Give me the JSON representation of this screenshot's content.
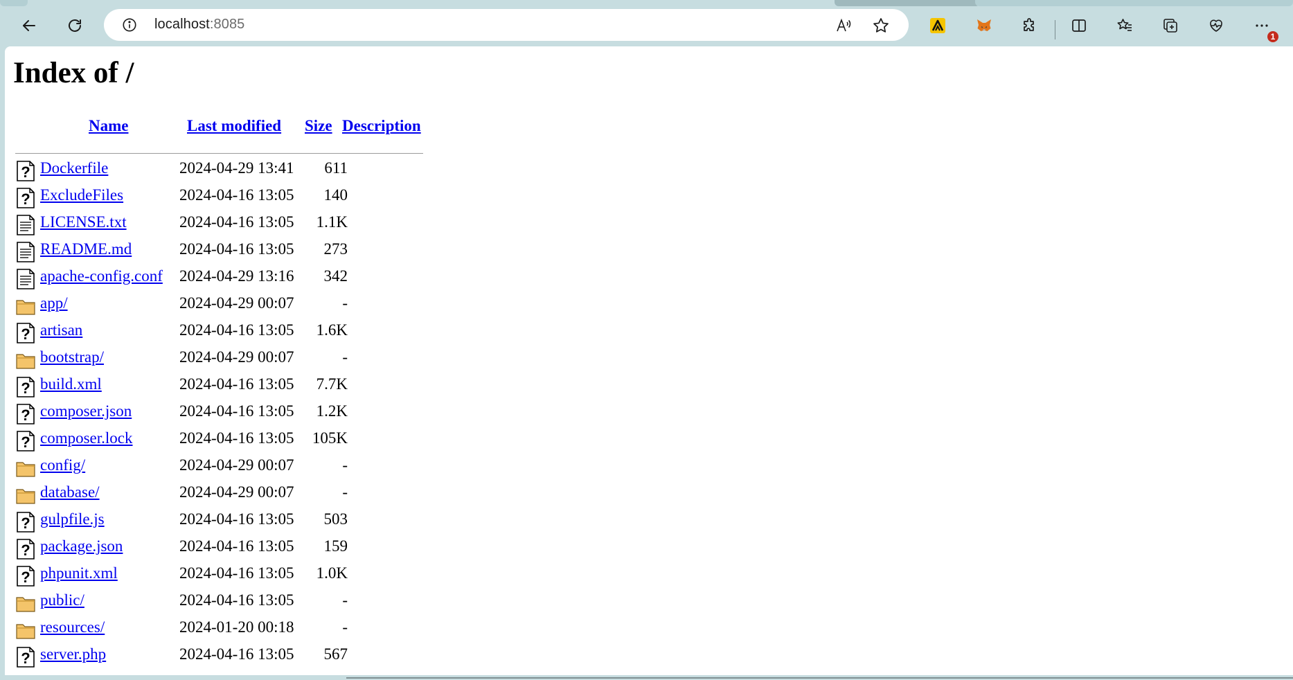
{
  "browser": {
    "url_host": "localhost",
    "url_port": ":8085",
    "url": "localhost:8085",
    "notification_count": "1",
    "toolbar_icons": [
      "back-icon",
      "refresh-icon",
      "info-icon",
      "read-aloud-icon",
      "favorite-star-icon",
      "extension-a-icon",
      "metamask-fox-icon",
      "extensions-puzzle-icon",
      "split-screen-icon",
      "favorites-icon",
      "collections-icon",
      "browser-essentials-icon",
      "more-icon"
    ]
  },
  "page": {
    "title": "Index of /",
    "columns": {
      "name": "Name",
      "last_modified": "Last modified",
      "size": "Size",
      "description": "Description"
    },
    "entries": [
      {
        "icon": "unknown-file-icon",
        "name": "Dockerfile",
        "modified": "2024-04-29 13:41",
        "size": "611",
        "description": ""
      },
      {
        "icon": "unknown-file-icon",
        "name": "ExcludeFiles",
        "modified": "2024-04-16 13:05",
        "size": "140",
        "description": ""
      },
      {
        "icon": "text-file-icon",
        "name": "LICENSE.txt",
        "modified": "2024-04-16 13:05",
        "size": "1.1K",
        "description": ""
      },
      {
        "icon": "text-file-icon",
        "name": "README.md",
        "modified": "2024-04-16 13:05",
        "size": "273",
        "description": ""
      },
      {
        "icon": "text-file-icon",
        "name": "apache-config.conf",
        "modified": "2024-04-29 13:16",
        "size": "342",
        "description": ""
      },
      {
        "icon": "folder-icon",
        "name": "app/",
        "modified": "2024-04-29 00:07",
        "size": "-",
        "description": ""
      },
      {
        "icon": "unknown-file-icon",
        "name": "artisan",
        "modified": "2024-04-16 13:05",
        "size": "1.6K",
        "description": ""
      },
      {
        "icon": "folder-icon",
        "name": "bootstrap/",
        "modified": "2024-04-29 00:07",
        "size": "-",
        "description": ""
      },
      {
        "icon": "unknown-file-icon",
        "name": "build.xml",
        "modified": "2024-04-16 13:05",
        "size": "7.7K",
        "description": ""
      },
      {
        "icon": "unknown-file-icon",
        "name": "composer.json",
        "modified": "2024-04-16 13:05",
        "size": "1.2K",
        "description": ""
      },
      {
        "icon": "unknown-file-icon",
        "name": "composer.lock",
        "modified": "2024-04-16 13:05",
        "size": "105K",
        "description": ""
      },
      {
        "icon": "folder-icon",
        "name": "config/",
        "modified": "2024-04-29 00:07",
        "size": "-",
        "description": ""
      },
      {
        "icon": "folder-icon",
        "name": "database/",
        "modified": "2024-04-29 00:07",
        "size": "-",
        "description": ""
      },
      {
        "icon": "unknown-file-icon",
        "name": "gulpfile.js",
        "modified": "2024-04-16 13:05",
        "size": "503",
        "description": ""
      },
      {
        "icon": "unknown-file-icon",
        "name": "package.json",
        "modified": "2024-04-16 13:05",
        "size": "159",
        "description": ""
      },
      {
        "icon": "unknown-file-icon",
        "name": "phpunit.xml",
        "modified": "2024-04-16 13:05",
        "size": "1.0K",
        "description": ""
      },
      {
        "icon": "folder-icon",
        "name": "public/",
        "modified": "2024-04-16 13:05",
        "size": "-",
        "description": ""
      },
      {
        "icon": "folder-icon",
        "name": "resources/",
        "modified": "2024-01-20 00:18",
        "size": "-",
        "description": ""
      },
      {
        "icon": "unknown-file-icon",
        "name": "server.php",
        "modified": "2024-04-16 13:05",
        "size": "567",
        "description": ""
      }
    ]
  },
  "colors": {
    "chrome_bg": "#c7dde0",
    "link": "#0000ee",
    "folder": "#f4c46a",
    "badge": "#c42b1c"
  }
}
